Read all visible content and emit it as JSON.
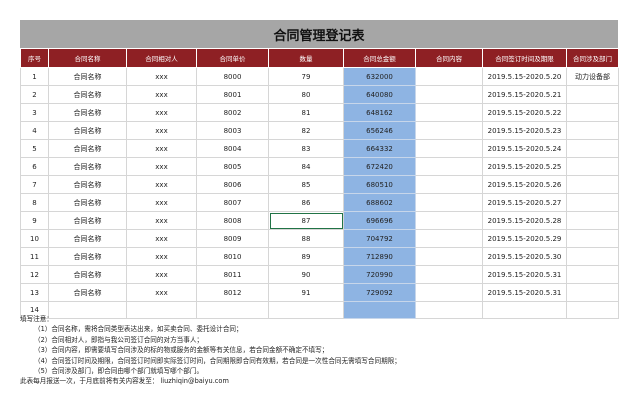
{
  "title": "合同管理登记表",
  "headers": [
    "序号",
    "合同名称",
    "合同相对人",
    "合同单价",
    "数量",
    "合同总金额",
    "合同内容",
    "合同签订时间及期限",
    "合同涉及部门"
  ],
  "rows": [
    {
      "no": "1",
      "name": "合同名称",
      "party": "xxx",
      "price": "8000",
      "qty": "79",
      "total": "632000",
      "content": "",
      "period": "2019.5.15-2020.5.20",
      "dept": "动力设备部"
    },
    {
      "no": "2",
      "name": "合同名称",
      "party": "xxx",
      "price": "8001",
      "qty": "80",
      "total": "640080",
      "content": "",
      "period": "2019.5.15-2020.5.21",
      "dept": ""
    },
    {
      "no": "3",
      "name": "合同名称",
      "party": "xxx",
      "price": "8002",
      "qty": "81",
      "total": "648162",
      "content": "",
      "period": "2019.5.15-2020.5.22",
      "dept": ""
    },
    {
      "no": "4",
      "name": "合同名称",
      "party": "xxx",
      "price": "8003",
      "qty": "82",
      "total": "656246",
      "content": "",
      "period": "2019.5.15-2020.5.23",
      "dept": ""
    },
    {
      "no": "5",
      "name": "合同名称",
      "party": "xxx",
      "price": "8004",
      "qty": "83",
      "total": "664332",
      "content": "",
      "period": "2019.5.15-2020.5.24",
      "dept": ""
    },
    {
      "no": "6",
      "name": "合同名称",
      "party": "xxx",
      "price": "8005",
      "qty": "84",
      "total": "672420",
      "content": "",
      "period": "2019.5.15-2020.5.25",
      "dept": ""
    },
    {
      "no": "7",
      "name": "合同名称",
      "party": "xxx",
      "price": "8006",
      "qty": "85",
      "total": "680510",
      "content": "",
      "period": "2019.5.15-2020.5.26",
      "dept": ""
    },
    {
      "no": "8",
      "name": "合同名称",
      "party": "xxx",
      "price": "8007",
      "qty": "86",
      "total": "688602",
      "content": "",
      "period": "2019.5.15-2020.5.27",
      "dept": ""
    },
    {
      "no": "9",
      "name": "合同名称",
      "party": "xxx",
      "price": "8008",
      "qty": "87",
      "total": "696696",
      "content": "",
      "period": "2019.5.15-2020.5.28",
      "dept": ""
    },
    {
      "no": "10",
      "name": "合同名称",
      "party": "xxx",
      "price": "8009",
      "qty": "88",
      "total": "704792",
      "content": "",
      "period": "2019.5.15-2020.5.29",
      "dept": ""
    },
    {
      "no": "11",
      "name": "合同名称",
      "party": "xxx",
      "price": "8010",
      "qty": "89",
      "total": "712890",
      "content": "",
      "period": "2019.5.15-2020.5.30",
      "dept": ""
    },
    {
      "no": "12",
      "name": "合同名称",
      "party": "xxx",
      "price": "8011",
      "qty": "90",
      "total": "720990",
      "content": "",
      "period": "2019.5.15-2020.5.31",
      "dept": ""
    },
    {
      "no": "13",
      "name": "合同名称",
      "party": "xxx",
      "price": "8012",
      "qty": "91",
      "total": "729092",
      "content": "",
      "period": "2019.5.15-2020.5.31",
      "dept": ""
    },
    {
      "no": "14",
      "name": "",
      "party": "",
      "price": "",
      "qty": "",
      "total": "",
      "content": "",
      "period": "",
      "dept": ""
    }
  ],
  "selected_row": 9,
  "notes": {
    "heading": "填写注意：",
    "items": [
      "（1）合同名称，需将合同类型表达出来，如买卖合同、委托设计合同；",
      "（2）合同相对人，即指与我公司签订合同的对方当事人；",
      "（3）合同内容，即需要填写合同涉及的标的物或服务的金额等有关信息，若合同金额不确定不填写；",
      "（4）合同签订时间及期限，合同签订时间即实际签订时间，合同期限即合同有效期，若合同是一次性合同无需填写合同期限；",
      "（5）合同涉及部门，即合同由哪个部门就填写哪个部门。"
    ],
    "footer": "此表每月报送一次，于月底前将有关内容发至：",
    "email": "liuzhiqin@baiyu.com"
  },
  "colors": {
    "header_bg": "#8e2024",
    "title_bg": "#a6a6a6",
    "total_bg": "#8eb4e3"
  }
}
